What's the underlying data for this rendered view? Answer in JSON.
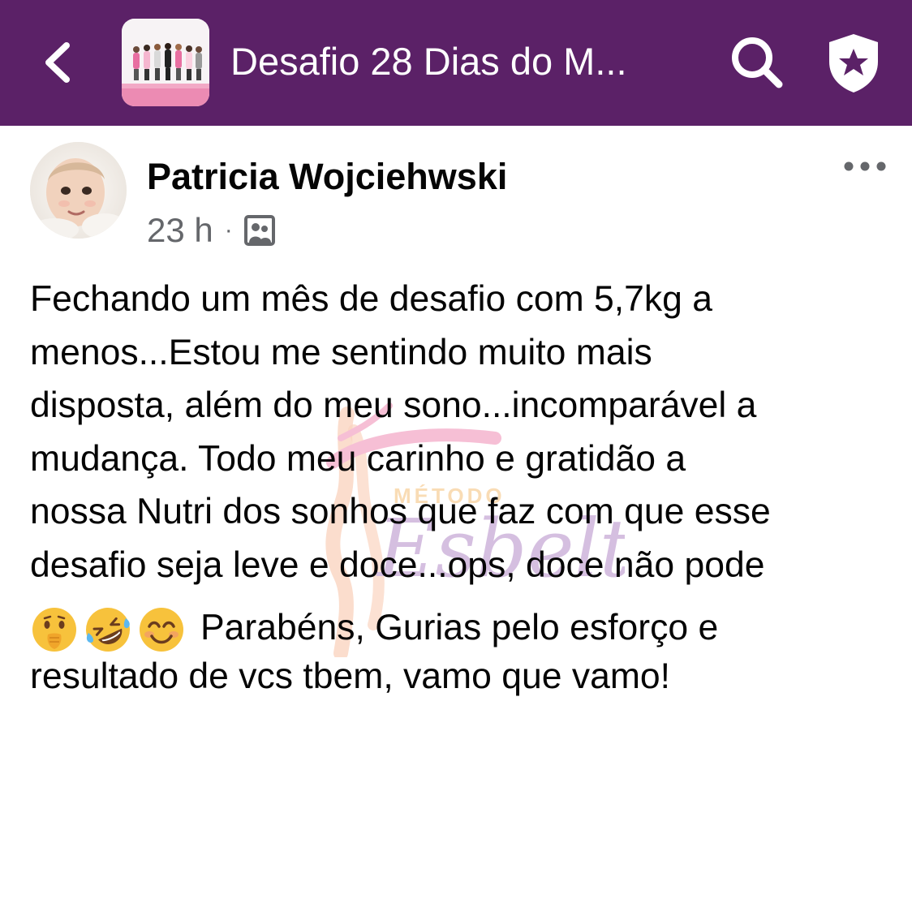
{
  "header": {
    "title": "Desafio 28 Dias do M...",
    "back_icon": "chevron-left-icon",
    "search_icon": "search-icon",
    "shield_icon": "shield-star-icon"
  },
  "post": {
    "author": "Patricia Wojciehwski",
    "time": "23 h",
    "separator": "·",
    "audience_icon": "group-photo-icon",
    "more_icon": "more-dots-icon",
    "lines": [
      "Fechando um mês de desafio com 5,7kg a",
      "menos...Estou me sentindo muito mais",
      "disposta, além do meu sono...incomparável a",
      "mudança. Todo meu carinho e gratidão a",
      "nossa Nutri dos sonhos que faz com que esse",
      "desafio seja leve e doce...ops, doce não pode"
    ],
    "emojis": [
      "🫢",
      "🤣",
      "😊"
    ],
    "emoji_names": [
      "face-with-hand-over-mouth-emoji",
      "rolling-laughing-emoji",
      "smiling-face-emoji"
    ],
    "emoji_line_text": "Parabéns, Gurias pelo esforço e",
    "last_line": "resultado de vcs tbem, vamo que vamo!"
  },
  "watermark": {
    "top_text": "MÉTODO",
    "script_text": "Esbelta"
  },
  "colors": {
    "header_bg": "#5b2167",
    "text": "#050505",
    "meta": "#65676b",
    "watermark_pink": "#f08cb4",
    "watermark_purple": "#b48cc8"
  }
}
